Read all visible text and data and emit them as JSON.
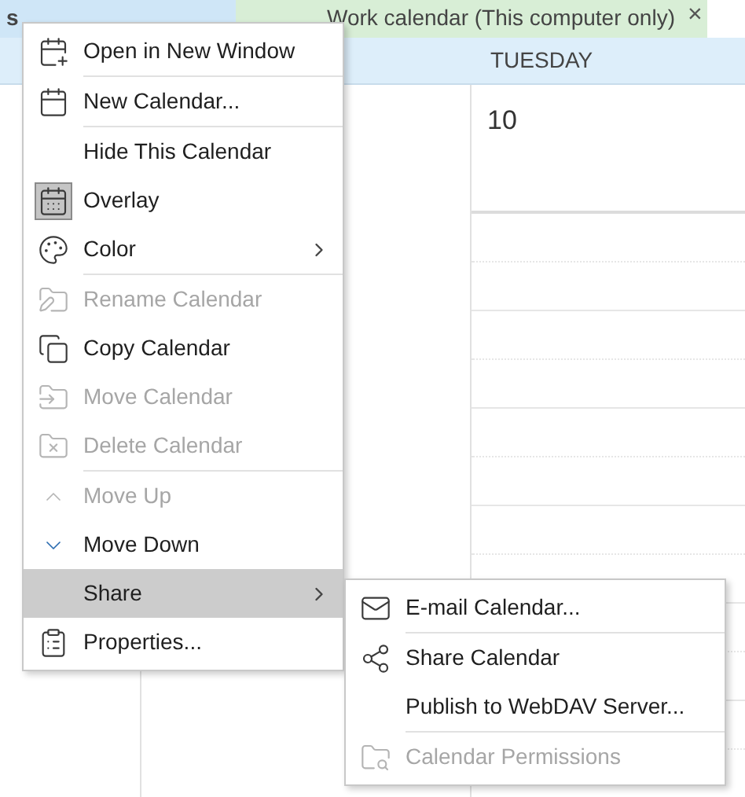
{
  "tabs": [
    {
      "label": "s",
      "selected": true,
      "color": "#cfe6f7"
    },
    {
      "label": "Work calendar (This computer only)",
      "close": "×",
      "selected": false,
      "color": "#d8eed6"
    }
  ],
  "calendar": {
    "day_header": "TUESDAY",
    "date": "10"
  },
  "context_menu": [
    {
      "kind": "item",
      "label": "Open in New Window",
      "disabled": false,
      "checked": false,
      "submenu": false,
      "selected": false
    },
    {
      "kind": "separator"
    },
    {
      "kind": "item",
      "label": "New Calendar...",
      "disabled": false,
      "checked": false,
      "submenu": false,
      "selected": false
    },
    {
      "kind": "separator"
    },
    {
      "kind": "item",
      "label": "Hide This Calendar",
      "disabled": false,
      "checked": false,
      "submenu": false,
      "selected": false
    },
    {
      "kind": "item",
      "label": "Overlay",
      "disabled": false,
      "checked": true,
      "submenu": false,
      "selected": false
    },
    {
      "kind": "item",
      "label": "Color",
      "disabled": false,
      "checked": false,
      "submenu": true,
      "selected": false
    },
    {
      "kind": "separator"
    },
    {
      "kind": "item",
      "label": "Rename Calendar",
      "disabled": true,
      "checked": false,
      "submenu": false,
      "selected": false
    },
    {
      "kind": "item",
      "label": "Copy Calendar",
      "disabled": false,
      "checked": false,
      "submenu": false,
      "selected": false
    },
    {
      "kind": "item",
      "label": "Move Calendar",
      "disabled": true,
      "checked": false,
      "submenu": false,
      "selected": false
    },
    {
      "kind": "item",
      "label": "Delete Calendar",
      "disabled": true,
      "checked": false,
      "submenu": false,
      "selected": false
    },
    {
      "kind": "separator"
    },
    {
      "kind": "item",
      "label": "Move Up",
      "disabled": true,
      "checked": false,
      "submenu": false,
      "selected": false
    },
    {
      "kind": "item",
      "label": "Move Down",
      "disabled": false,
      "checked": false,
      "submenu": false,
      "selected": false
    },
    {
      "kind": "item",
      "label": "Share",
      "disabled": false,
      "checked": false,
      "submenu": true,
      "selected": true
    },
    {
      "kind": "item",
      "label": "Properties...",
      "disabled": false,
      "checked": false,
      "submenu": false,
      "selected": false
    }
  ],
  "share_submenu": [
    {
      "kind": "item",
      "label": "E-mail Calendar...",
      "disabled": false,
      "selected": false
    },
    {
      "kind": "separator"
    },
    {
      "kind": "item",
      "label": "Share Calendar",
      "disabled": false,
      "selected": false
    },
    {
      "kind": "item",
      "label": "Publish to WebDAV Server...",
      "disabled": false,
      "selected": false
    },
    {
      "kind": "separator"
    },
    {
      "kind": "item",
      "label": "Calendar Permissions",
      "disabled": true,
      "selected": false
    }
  ]
}
